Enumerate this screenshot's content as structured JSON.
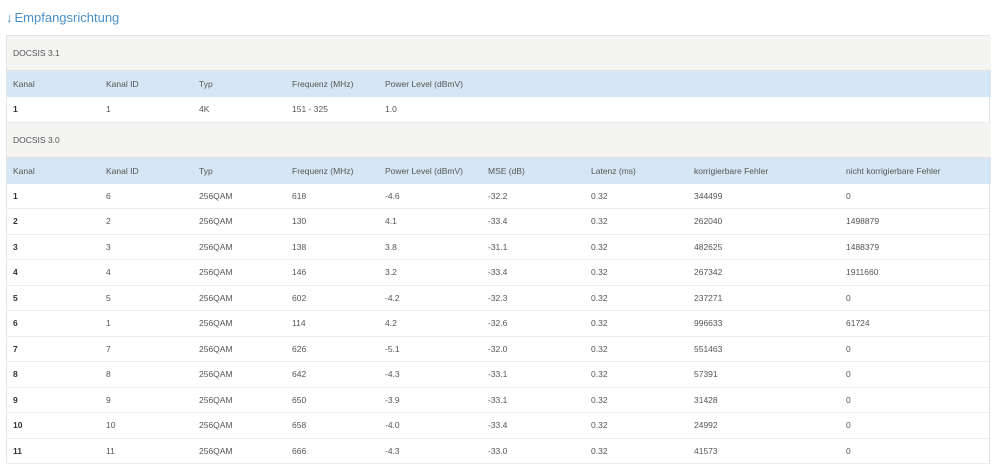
{
  "section": {
    "arrow": "↓",
    "title": "Empfangsrichtung"
  },
  "docsis31": {
    "label": "DOCSIS 3.1",
    "headers": [
      "Kanal",
      "Kanal ID",
      "Typ",
      "Frequenz (MHz)",
      "Power Level (dBmV)"
    ],
    "rows": [
      [
        "1",
        "1",
        "4K",
        "151 - 325",
        "1.0"
      ]
    ]
  },
  "docsis30": {
    "label": "DOCSIS 3.0",
    "headers": [
      "Kanal",
      "Kanal ID",
      "Typ",
      "Frequenz (MHz)",
      "Power Level (dBmV)",
      "MSE (dB)",
      "Latenz (ms)",
      "korrigierbare Fehler",
      "nicht korrigierbare Fehler"
    ],
    "rows": [
      [
        "1",
        "6",
        "256QAM",
        "618",
        "-4.6",
        "-32.2",
        "0.32",
        "344499",
        "0"
      ],
      [
        "2",
        "2",
        "256QAM",
        "130",
        "4.1",
        "-33.4",
        "0.32",
        "262040",
        "1498879"
      ],
      [
        "3",
        "3",
        "256QAM",
        "138",
        "3.8",
        "-31.1",
        "0.32",
        "482625",
        "1488379"
      ],
      [
        "4",
        "4",
        "256QAM",
        "146",
        "3.2",
        "-33.4",
        "0.32",
        "267342",
        "1911660"
      ],
      [
        "5",
        "5",
        "256QAM",
        "602",
        "-4.2",
        "-32.3",
        "0.32",
        "237271",
        "0"
      ],
      [
        "6",
        "1",
        "256QAM",
        "114",
        "4.2",
        "-32.6",
        "0.32",
        "996633",
        "61724"
      ],
      [
        "7",
        "7",
        "256QAM",
        "626",
        "-5.1",
        "-32.0",
        "0.32",
        "551463",
        "0"
      ],
      [
        "8",
        "8",
        "256QAM",
        "642",
        "-4.3",
        "-33.1",
        "0.32",
        "57391",
        "0"
      ],
      [
        "9",
        "9",
        "256QAM",
        "650",
        "-3.9",
        "-33.1",
        "0.32",
        "31428",
        "0"
      ],
      [
        "10",
        "10",
        "256QAM",
        "658",
        "-4.0",
        "-33.4",
        "0.32",
        "24992",
        "0"
      ],
      [
        "11",
        "11",
        "256QAM",
        "666",
        "-4.3",
        "-33.0",
        "0.32",
        "41573",
        "0"
      ]
    ]
  }
}
